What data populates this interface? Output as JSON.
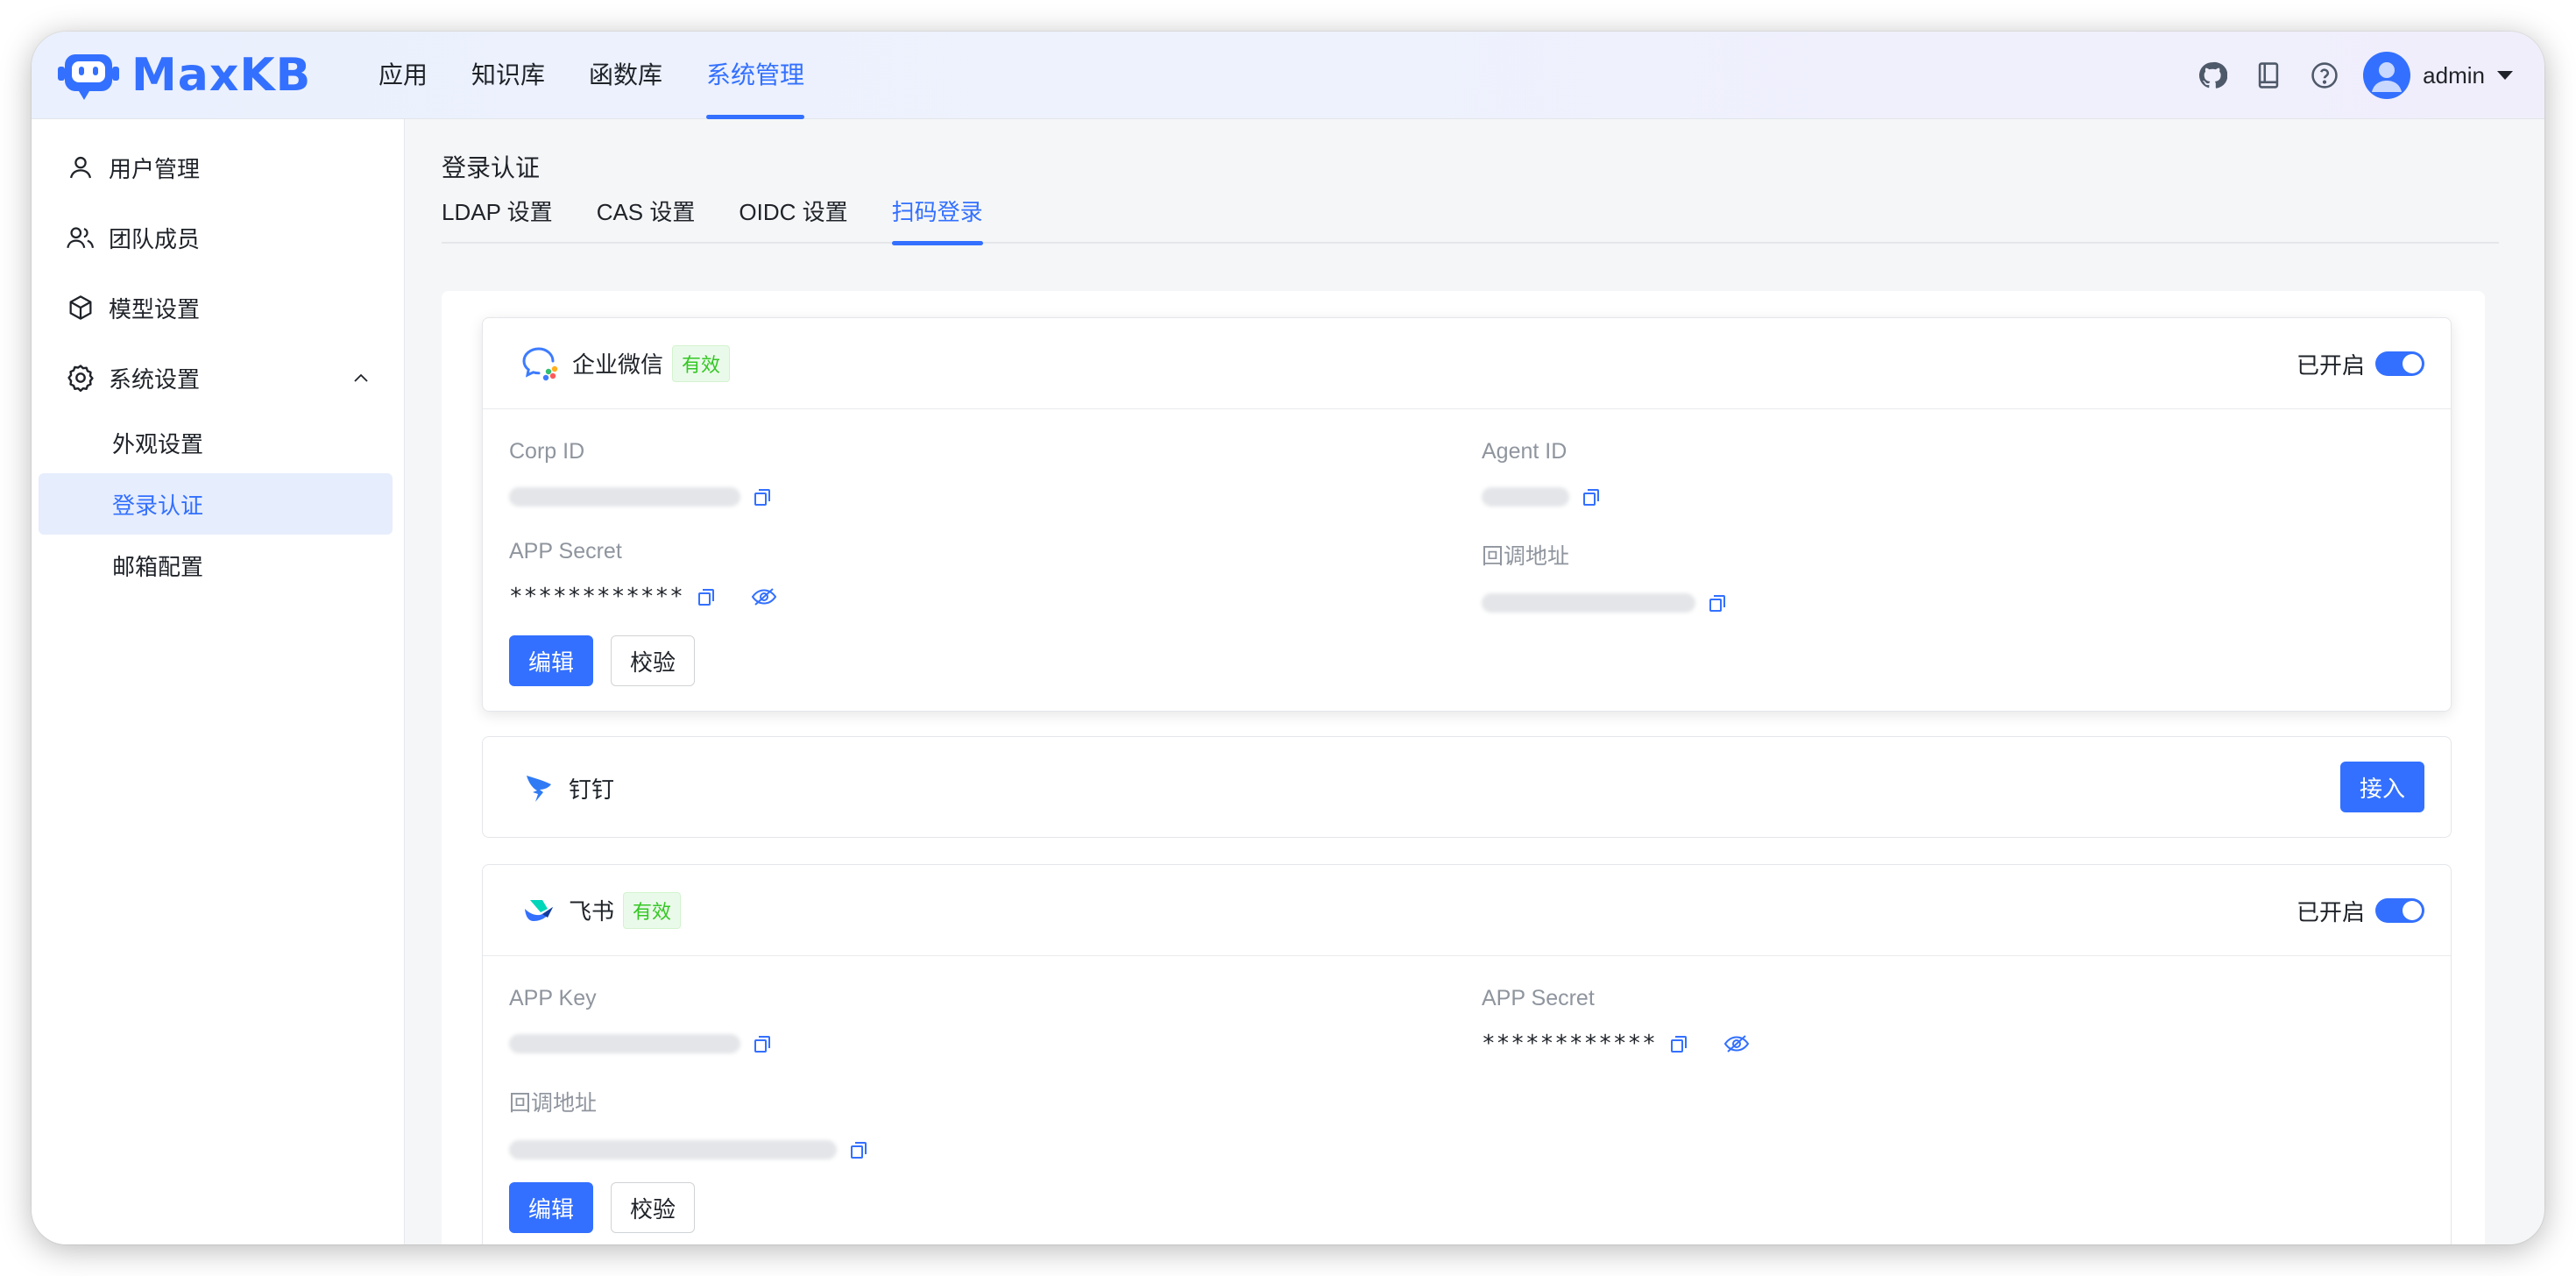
{
  "app": {
    "name": "MaxKB",
    "user": "admin"
  },
  "nav": [
    "应用",
    "知识库",
    "函数库",
    "系统管理"
  ],
  "header_icons": [
    "github-icon",
    "book-icon",
    "help-icon"
  ],
  "sidebar": {
    "items": [
      "用户管理",
      "团队成员",
      "模型设置",
      "系统设置"
    ],
    "sub_items": [
      "外观设置",
      "登录认证",
      "邮箱配置"
    ]
  },
  "page": {
    "title": "登录认证",
    "tabs": [
      "LDAP 设置",
      "CAS 设置",
      "OIDC 设置",
      "扫码登录"
    ]
  },
  "wecom": {
    "name": "企业微信",
    "badge": "有效",
    "switch_label": "已开启",
    "corp_id_label": "Corp ID",
    "agent_id_label": "Agent ID",
    "app_secret_label": "APP Secret",
    "app_secret_value": "************",
    "callback_label": "回调地址",
    "edit": "编辑",
    "verify": "校验"
  },
  "dingtalk": {
    "name": "钉钉",
    "connect": "接入"
  },
  "feishu": {
    "name": "飞书",
    "badge": "有效",
    "switch_label": "已开启",
    "app_key_label": "APP Key",
    "app_secret_label": "APP Secret",
    "app_secret_value": "************",
    "callback_label": "回调地址",
    "edit": "编辑",
    "verify": "校验"
  },
  "colors": {
    "accent": "#3370ff",
    "success": "#34c724"
  }
}
